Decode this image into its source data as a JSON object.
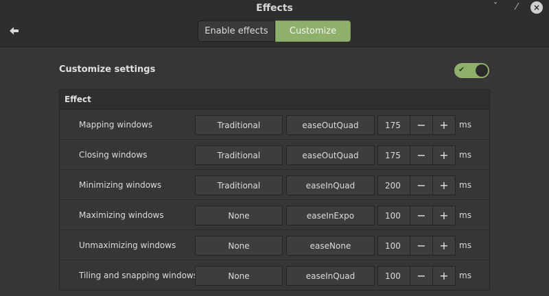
{
  "window": {
    "title": "Effects",
    "minimize_glyph": "ˇ",
    "maximize_glyph": "⁄",
    "close_glyph": "×"
  },
  "tabs": [
    {
      "label": "Enable effects",
      "active": false
    },
    {
      "label": "Customize",
      "active": true
    }
  ],
  "section": {
    "title": "Customize settings",
    "toggle_on": true,
    "toggle_check": "✔"
  },
  "table": {
    "header": "Effect",
    "unit": "ms",
    "minus": "−",
    "plus": "+",
    "rows": [
      {
        "label": "Mapping windows",
        "type": "Traditional",
        "easing": "easeOutQuad",
        "duration": "175"
      },
      {
        "label": "Closing windows",
        "type": "Traditional",
        "easing": "easeOutQuad",
        "duration": "175"
      },
      {
        "label": "Minimizing windows",
        "type": "Traditional",
        "easing": "easeInQuad",
        "duration": "200"
      },
      {
        "label": "Maximizing windows",
        "type": "None",
        "easing": "easeInExpo",
        "duration": "100"
      },
      {
        "label": "Unmaximizing windows",
        "type": "None",
        "easing": "easeNone",
        "duration": "100"
      },
      {
        "label": "Tiling and snapping windows",
        "type": "None",
        "easing": "easeInQuad",
        "duration": "100"
      }
    ]
  },
  "colors": {
    "accent": "#8fb06a",
    "background": "#363636",
    "titlebar": "#2e2e2e"
  }
}
